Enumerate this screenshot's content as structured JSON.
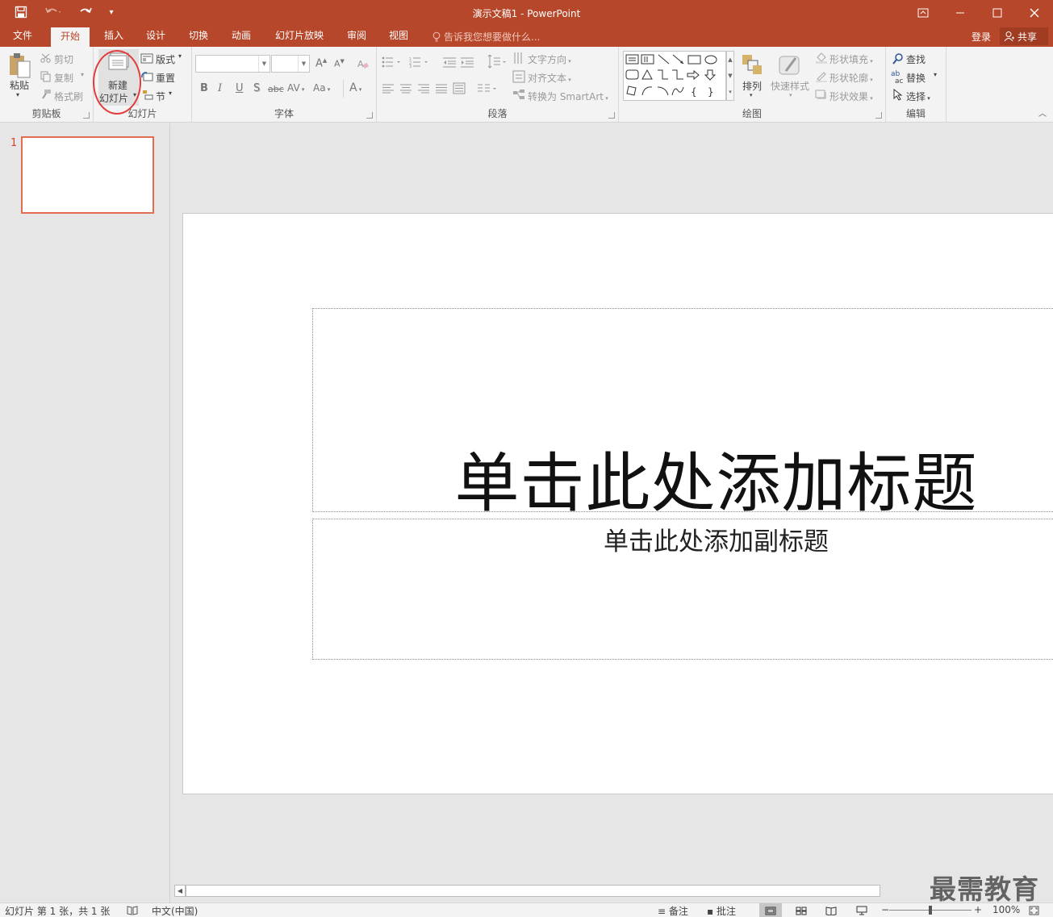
{
  "window": {
    "title": "演示文稿1 - PowerPoint"
  },
  "tabs": [
    {
      "label": "文件"
    },
    {
      "label": "开始"
    },
    {
      "label": "插入"
    },
    {
      "label": "设计"
    },
    {
      "label": "切换"
    },
    {
      "label": "动画"
    },
    {
      "label": "幻灯片放映"
    },
    {
      "label": "审阅"
    },
    {
      "label": "视图"
    }
  ],
  "tell_me": "告诉我您想要做什么...",
  "login": "登录",
  "share": "共享",
  "ribbon": {
    "clipboard": {
      "paste": "粘贴",
      "cut": "剪切",
      "copy": "复制",
      "format_painter": "格式刷",
      "label": "剪贴板"
    },
    "slides": {
      "new_slide_line1": "新建",
      "new_slide_line2": "幻灯片",
      "layout": "版式",
      "reset": "重置",
      "section": "节",
      "label": "幻灯片"
    },
    "font": {
      "label": "字体",
      "bold": "B",
      "italic": "I",
      "underline": "U",
      "shadow": "S",
      "strike": "abc",
      "spacing": "AV",
      "case": "Aa",
      "color": "A",
      "grow": "A",
      "shrink": "A"
    },
    "paragraph": {
      "label": "段落",
      "text_direction": "文字方向",
      "align_text": "对齐文本",
      "smartart": "转换为 SmartArt"
    },
    "drawing": {
      "label": "绘图",
      "arrange": "排列",
      "quick_styles": "快速样式",
      "shape_fill": "形状填充",
      "shape_outline": "形状轮廓",
      "shape_effects": "形状效果"
    },
    "editing": {
      "label": "编辑",
      "find": "查找",
      "replace": "替换",
      "select": "选择"
    }
  },
  "thumbnails": [
    {
      "number": "1"
    }
  ],
  "slide": {
    "title_placeholder": "单击此处添加标题",
    "subtitle_placeholder": "单击此处添加副标题"
  },
  "watermark": "最需教育",
  "status": {
    "slide_info": "幻灯片 第 1 张，共 1 张",
    "language": "中文(中国)",
    "notes": "备注",
    "comments": "批注",
    "zoom": "100%"
  },
  "colors": {
    "accent": "#b7472a",
    "selection": "#e46c51",
    "annotation_circle": "#e23b3b"
  }
}
